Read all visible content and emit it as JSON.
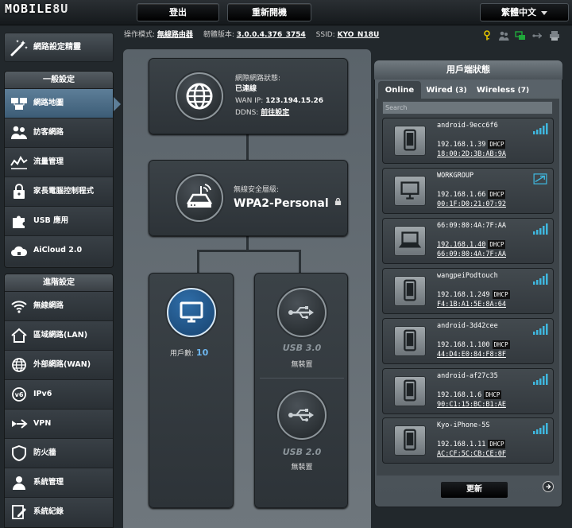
{
  "header": {
    "logo_text": "MOBILE",
    "logo_suffix": "8U",
    "logout_label": "登出",
    "reboot_label": "重新開機",
    "language_label": "繁體中文"
  },
  "infobar": {
    "mode_label": "操作模式:",
    "mode_value": "無線路由器",
    "firmware_label": "韌體版本:",
    "firmware_value": "3.0.0.4.376_3754",
    "ssid_label": "SSID:",
    "ssid_value": "KYO_N18U"
  },
  "sidebar": {
    "qis_label": "網路設定精靈",
    "general_header": "一般設定",
    "general_items": [
      {
        "label": "網路地圖"
      },
      {
        "label": "訪客網路"
      },
      {
        "label": "流量管理"
      },
      {
        "label": "家長電腦控制程式"
      },
      {
        "label": "USB 應用"
      },
      {
        "label": "AiCloud 2.0"
      }
    ],
    "advanced_header": "進階設定",
    "advanced_items": [
      {
        "label": "無線網路"
      },
      {
        "label": "區域網路(LAN)"
      },
      {
        "label": "外部網路(WAN)"
      },
      {
        "label": "IPv6"
      },
      {
        "label": "VPN"
      },
      {
        "label": "防火牆"
      },
      {
        "label": "系統管理"
      },
      {
        "label": "系統紀錄"
      }
    ]
  },
  "map": {
    "internet_status_label": "網際網路狀態:",
    "internet_status_value": "已連線",
    "wan_ip_label": "WAN IP:",
    "wan_ip_value": "123.194.15.26",
    "ddns_label": "DDNS:",
    "ddns_value": "前往設定",
    "security_label": "無線安全層級:",
    "security_value": "WPA2-Personal",
    "clients_label": "用戶數:",
    "clients_value": "10",
    "usb3_label": "USB 3.0",
    "usb3_status": "無裝置",
    "usb2_label": "USB 2.0",
    "usb2_status": "無裝置"
  },
  "client_panel": {
    "title": "用戶端狀態",
    "tabs": [
      {
        "label": "Online",
        "count": ""
      },
      {
        "label": "Wired",
        "count": "(3)"
      },
      {
        "label": "Wireless",
        "count": "(7)"
      }
    ],
    "search_placeholder": "Search",
    "clients": [
      {
        "name": "android-9ecc6f6",
        "ip": "192.168.1.39",
        "dhcp": "DHCP",
        "mac": "18:00:2D:3B:AB:9A",
        "device": "phone-icon",
        "link": "wifi"
      },
      {
        "name": "WORKGROUP",
        "ip": "192.168.1.66",
        "dhcp": "DHCP",
        "mac": "00:1F:D0:21:07:92",
        "device": "desktop-icon",
        "link": "wired"
      },
      {
        "name": "66:09:80:4A:7F:AA",
        "ip": "192.168.1.40",
        "dhcp": "DHCP",
        "mac": "66:09:80:4A:7F:AA",
        "device": "laptop-icon",
        "link": "wifi"
      },
      {
        "name": "wangpeiPodtouch",
        "ip": "192.168.1.249",
        "dhcp": "DHCP",
        "mac": "F4:1B:A1:5E:8A:64",
        "device": "phone-icon",
        "link": "wifi"
      },
      {
        "name": "android-3d42cee",
        "ip": "192.168.1.100",
        "dhcp": "DHCP",
        "mac": "44:D4:E0:84:F8:8F",
        "device": "phone-icon",
        "link": "wifi"
      },
      {
        "name": "android-af27c35",
        "ip": "192.168.1.6",
        "dhcp": "DHCP",
        "mac": "90:C1:15:BC:B1:AE",
        "device": "phone-icon",
        "link": "wifi"
      },
      {
        "name": "Kyo-iPhone-5S",
        "ip": "192.168.1.11",
        "dhcp": "DHCP",
        "mac": "AC:CF:5C:CB:CE:0F",
        "device": "phone-icon",
        "link": "wifi"
      }
    ],
    "refresh_label": "更新"
  },
  "colors": {
    "accent": "#5d7e98",
    "highlight_blue": "#2f6ea9",
    "signal_green": "#3fb8e0",
    "status_green": "#1fa83a",
    "status_yellow": "#e2c300"
  }
}
